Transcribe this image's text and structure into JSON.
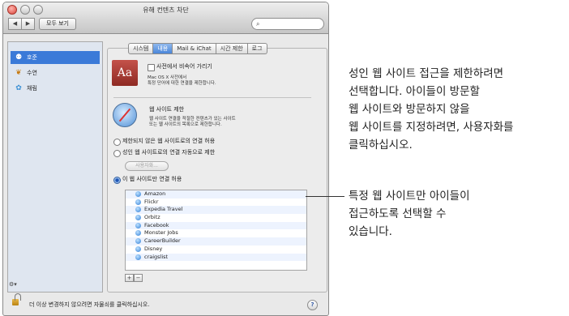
{
  "window": {
    "title": "유해 컨텐츠 차단",
    "show_all": "모두 보기",
    "back_icon": "◀",
    "forward_icon": "▶"
  },
  "search": {
    "placeholder": ""
  },
  "sidebar": {
    "items": [
      {
        "label": "호준",
        "icon": "user-icon",
        "selected": true
      },
      {
        "label": "수연",
        "icon": "butterfly-icon",
        "selected": false
      },
      {
        "label": "채림",
        "icon": "flower-icon",
        "selected": false
      }
    ],
    "gear": "⚙▾"
  },
  "tabs": [
    {
      "label": "시스템",
      "active": false
    },
    {
      "label": "내용",
      "active": true
    },
    {
      "label": "Mail & iChat",
      "active": false
    },
    {
      "label": "시간 제한",
      "active": false
    },
    {
      "label": "로그",
      "active": false
    }
  ],
  "dictionary": {
    "icon_text": "Aa",
    "checkbox_label": "사전에서 비속어 가리기",
    "desc_line1": "Mac OS X 사전에서",
    "desc_line2": "특정 단어에 대한 연결을 제한합니다."
  },
  "websites": {
    "title": "웹 사이트 제한",
    "desc_line1": "웹 사이트 연결을 적절한 컨텐츠가 있는 사이트",
    "desc_line2": "또는 웹 사이트의 목록으로 제한합니다.",
    "options": [
      {
        "label": "제한되지 않은 웹 사이트로의 연결 허용",
        "selected": false
      },
      {
        "label": "성인 웹 사이트로의 연결 자동으로 제한",
        "selected": false
      },
      {
        "label": "이 웹 사이트만 연결 허용",
        "selected": true
      }
    ],
    "customize_button": "사용자화...",
    "sites": [
      "Amazon",
      "Flickr",
      "Expedia Travel",
      "Orbitz",
      "Facebook",
      "Monster Jobs",
      "CareerBuilder",
      "Disney",
      "craigslist"
    ],
    "add_label": "+",
    "remove_label": "−"
  },
  "footer": {
    "lock_text": "더 이상 변경하지 않으려면 자물쇠를 클릭하십시오.",
    "help_label": "?"
  },
  "callouts": {
    "top": [
      "성인 웹 사이트 접근을 제한하려면",
      "선택합니다. 아이들이 방문할",
      "웹 사이트와 방문하지 않을",
      "웹 사이트를 지정하려면, 사용자화를",
      "클릭하십시오."
    ],
    "bottom": [
      "특정 웹 사이트만 아이들이",
      "접근하도록 선택할 수",
      "있습니다."
    ]
  },
  "colors": {
    "selection": "#3b7ad8",
    "active_tab": "#4a86d9",
    "window_bg": "#e9e9e9"
  }
}
